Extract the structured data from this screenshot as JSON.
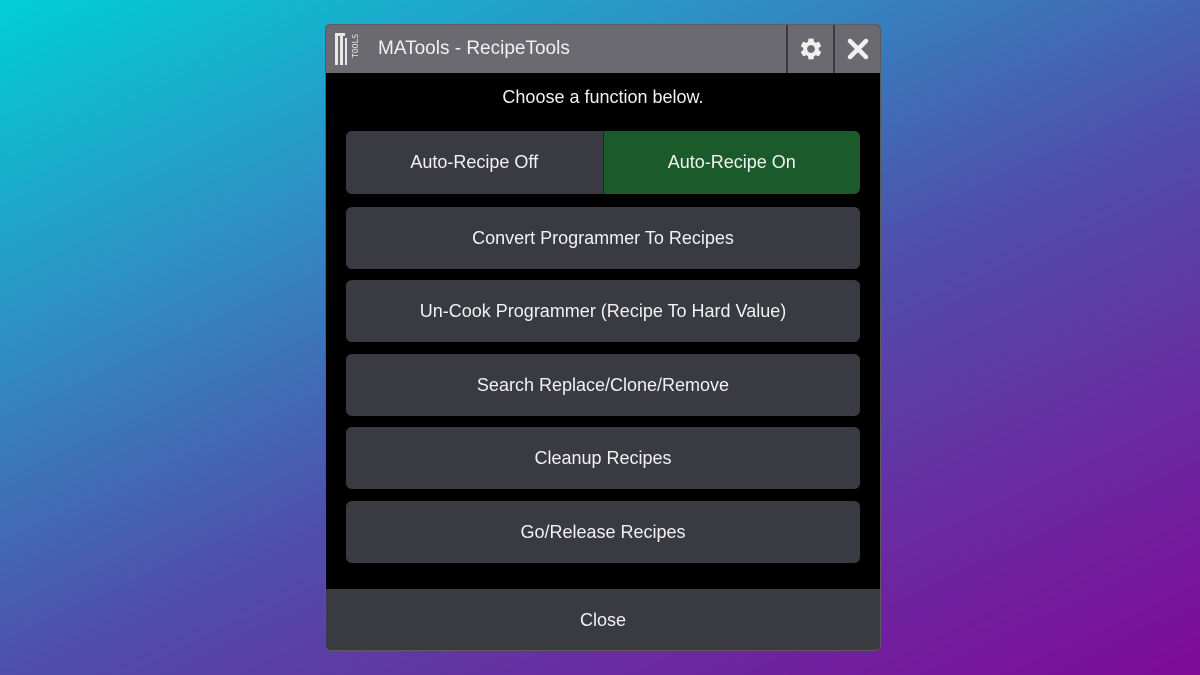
{
  "window": {
    "title": "MATools - RecipeTools",
    "logo_text": "MATOOLS",
    "settings_icon": "gear-icon",
    "close_icon": "close-icon"
  },
  "instruction": "Choose a function below.",
  "auto_recipe": {
    "off_label": "Auto-Recipe Off",
    "on_label": "Auto-Recipe On",
    "active": "on",
    "active_color": "#1b5a2a"
  },
  "functions": [
    "Convert Programmer To Recipes",
    "Un-Cook Programmer (Recipe To Hard Value)",
    "Search Replace/Clone/Remove",
    "Cleanup Recipes",
    "Go/Release Recipes"
  ],
  "footer": {
    "close_label": "Close"
  }
}
